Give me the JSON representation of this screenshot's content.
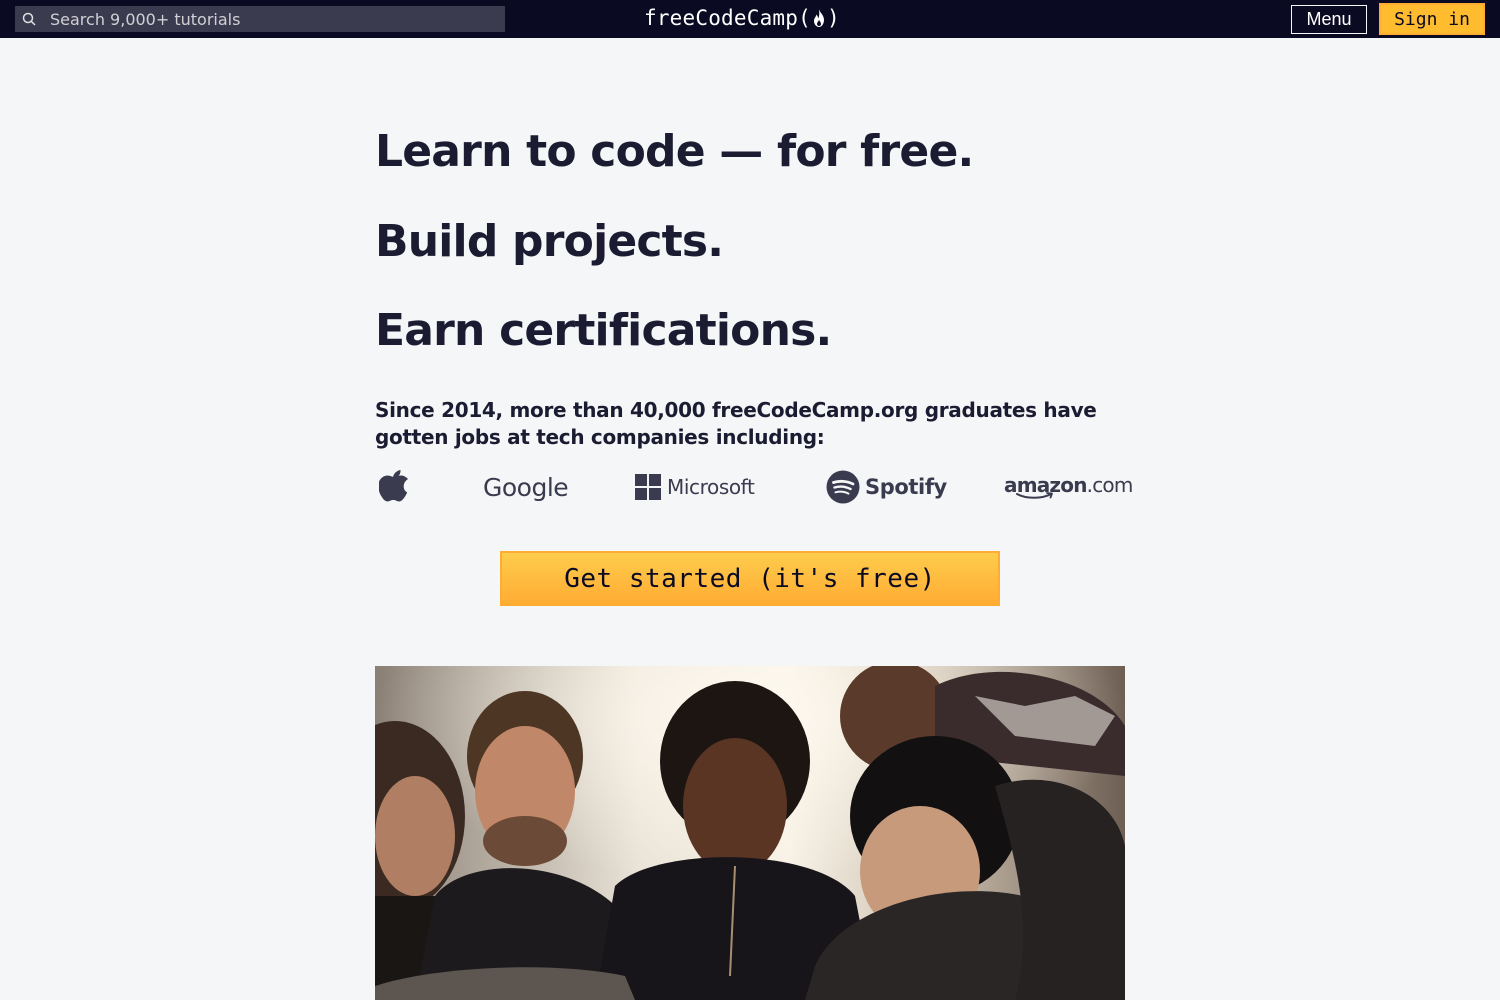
{
  "nav": {
    "search_placeholder": "Search 9,000+ tutorials",
    "logo_text_left": "freeCodeCamp(",
    "logo_text_right": ")",
    "menu_label": "Menu",
    "signin_label": "Sign in"
  },
  "hero": {
    "line1": "Learn to code — for free.",
    "line2": "Build projects.",
    "line3": "Earn certifications.",
    "since": "Since 2014, more than 40,000 freeCodeCamp.org graduates have gotten jobs at tech companies including:"
  },
  "companies": {
    "apple": "apple-logo",
    "google": "Google",
    "microsoft": "Microsoft",
    "spotify": "Spotify",
    "amazon_main": "amazon",
    "amazon_suffix": ".com"
  },
  "cta": {
    "label": "Get started (it's free)"
  },
  "photo": {
    "alt": "Students collaborating around a laptop"
  },
  "colors": {
    "nav_bg": "#0a0a23",
    "page_bg": "#f5f6f7",
    "accent": "#febc2e",
    "text": "#1b1b32"
  }
}
